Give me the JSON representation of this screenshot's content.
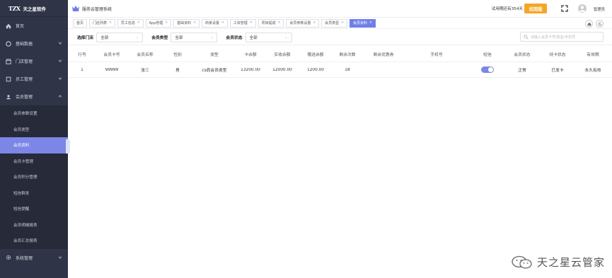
{
  "sidebar": {
    "logo_mark": "TZX",
    "logo_name": "天之星软件",
    "items": [
      {
        "label": "首页"
      },
      {
        "label": "基础数据"
      },
      {
        "label": "门店管理"
      },
      {
        "label": "员工管理"
      },
      {
        "label": "会员管理"
      }
    ],
    "sub_items": [
      {
        "label": "会员参数设置"
      },
      {
        "label": "会员类型"
      },
      {
        "label": "会员资料"
      },
      {
        "label": "会员卡管理"
      },
      {
        "label": "会员积分管理"
      },
      {
        "label": "短信群发"
      },
      {
        "label": "短信提醒"
      },
      {
        "label": "会员明细报表"
      },
      {
        "label": "会员汇总报表"
      }
    ],
    "bottom_item": {
      "label": "系统管理"
    },
    "active_color": "#7b86e6"
  },
  "header": {
    "system_title": "服务云管理系统",
    "trial_text": "试用期还有354天",
    "trial_button": "试用版",
    "user_name": "管理员"
  },
  "tabs": [
    {
      "label": "首页",
      "closable": false
    },
    {
      "label": "门店列表",
      "closable": true
    },
    {
      "label": "员工信息",
      "closable": true
    },
    {
      "label": "App管理",
      "closable": true
    },
    {
      "label": "基础资料",
      "closable": true
    },
    {
      "label": "商家设置",
      "closable": true
    },
    {
      "label": "工资管理",
      "closable": true
    },
    {
      "label": "项目提成",
      "closable": true
    },
    {
      "label": "会员参数设置",
      "closable": true
    },
    {
      "label": "会员类型",
      "closable": true
    },
    {
      "label": "会员资料",
      "closable": true,
      "active": true
    }
  ],
  "filters": {
    "store": {
      "label": "选择门店",
      "value": "全部"
    },
    "member_type": {
      "label": "会员类型",
      "value": "全部"
    },
    "member_status": {
      "label": "会员状态",
      "value": "全部"
    },
    "search_placeholder": "请输入会员卡号/姓名/手机号"
  },
  "table": {
    "columns": [
      "行号",
      "会员卡号",
      "会员名称",
      "性别",
      "类型",
      "卡余额",
      "实收余额",
      "赠送余额",
      "剩余次数",
      "剩余优惠券",
      "手机号",
      "短信",
      "会员状态",
      "持卡状态",
      "有效期"
    ],
    "rows": [
      {
        "cells": [
          "1",
          "99999",
          "张三",
          "男",
          "cs肩会员类型",
          "13200.00",
          "12000.00",
          "1200.00",
          "18",
          "",
          "",
          "",
          "正常",
          "已发卡",
          "永久有效"
        ],
        "sms_enabled": true
      }
    ]
  },
  "watermark": {
    "text": "天之星云管家"
  },
  "colors": {
    "accent": "#7b86e6",
    "trial": "#f5a623",
    "sidebar_bg": "#2f3447"
  }
}
